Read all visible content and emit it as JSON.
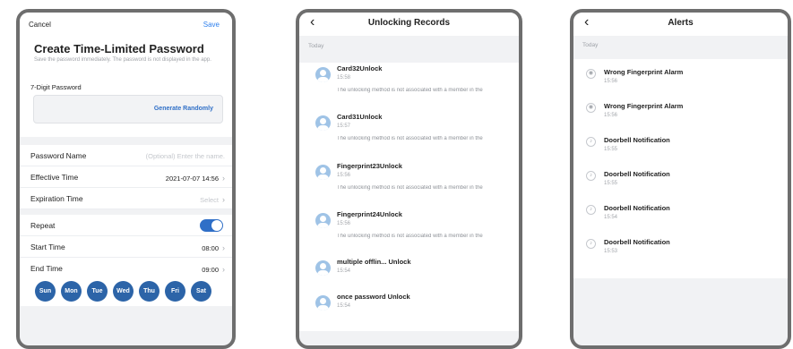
{
  "phone1": {
    "cancel": "Cancel",
    "save": "Save",
    "title": "Create Time-Limited Password",
    "subtitle": "Save the password immediately. The password is not displayed in the app.",
    "password_label": "7-Digit Password",
    "generate": "Generate Randomly",
    "rows": {
      "password_name": {
        "label": "Password Name",
        "placeholder": "(Optional) Enter the name."
      },
      "effective_time": {
        "label": "Effective Time",
        "value": "2021-07-07 14:56"
      },
      "expiration_time": {
        "label": "Expiration Time",
        "placeholder": "Select"
      },
      "repeat": {
        "label": "Repeat",
        "on": true
      },
      "start_time": {
        "label": "Start Time",
        "value": "08:00"
      },
      "end_time": {
        "label": "End Time",
        "value": "09:00"
      }
    },
    "days": [
      "Sun",
      "Mon",
      "Tue",
      "Wed",
      "Thu",
      "Fri",
      "Sat"
    ],
    "accent": "#2c64a8"
  },
  "phone2": {
    "title": "Unlocking Records",
    "section": "Today",
    "records": [
      {
        "title": "Card32Unlock",
        "time": "15:58",
        "desc": "The unlocking method is not associated with a member in the"
      },
      {
        "title": "Card31Unlock",
        "time": "15:57",
        "desc": "The unlocking method is not associated with a member in the"
      },
      {
        "title": "Fingerprint23Unlock",
        "time": "15:56",
        "desc": "The unlocking method is not associated with a member in the"
      },
      {
        "title": "Fingerprint24Unlock",
        "time": "15:56",
        "desc": "The unlocking method is not associated with a member in the"
      },
      {
        "title": "multiple offlin... Unlock",
        "time": "15:54",
        "desc": ""
      },
      {
        "title": "once password Unlock",
        "time": "15:54",
        "desc": ""
      }
    ]
  },
  "phone3": {
    "title": "Alerts",
    "section": "Today",
    "alerts": [
      {
        "title": "Wrong Fingerprint Alarm",
        "time": "15:56",
        "icon": "fingerprint-icon"
      },
      {
        "title": "Wrong Fingerprint Alarm",
        "time": "15:56",
        "icon": "fingerprint-icon"
      },
      {
        "title": "Doorbell Notification",
        "time": "15:55",
        "icon": "bell-icon"
      },
      {
        "title": "Doorbell Notification",
        "time": "15:55",
        "icon": "bell-icon"
      },
      {
        "title": "Doorbell Notification",
        "time": "15:54",
        "icon": "bell-icon"
      },
      {
        "title": "Doorbell Notification",
        "time": "15:53",
        "icon": "bell-icon"
      }
    ]
  }
}
